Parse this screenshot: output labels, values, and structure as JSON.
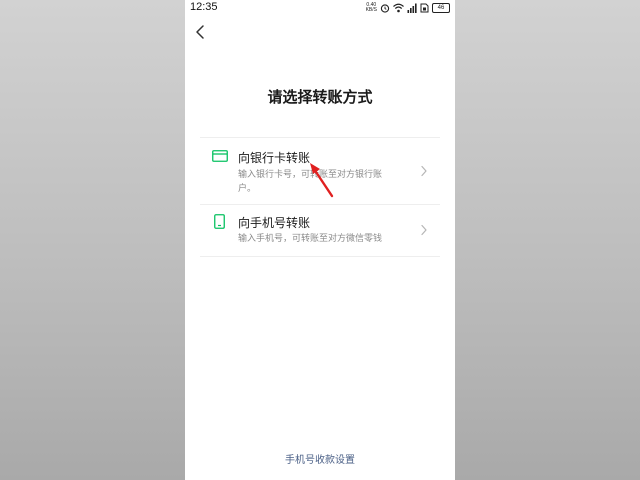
{
  "status_bar": {
    "time": "12:35",
    "net_speed_value": "0.40",
    "net_speed_unit": "KB/S",
    "battery": "46"
  },
  "header": {
    "back_icon": "chevron-left-icon",
    "title": "请选择转账方式"
  },
  "options": [
    {
      "icon": "bank-card-icon",
      "title": "向银行卡转账",
      "description": "输入银行卡号，可转账至对方银行账户。"
    },
    {
      "icon": "mobile-phone-icon",
      "title": "向手机号转账",
      "description": "输入手机号，可转账至对方微信零钱"
    }
  ],
  "footer": {
    "link": "手机号收款设置"
  },
  "colors": {
    "accent_green": "#07c160",
    "link_blue": "#4a5f86",
    "annotation_red": "#e02020"
  }
}
